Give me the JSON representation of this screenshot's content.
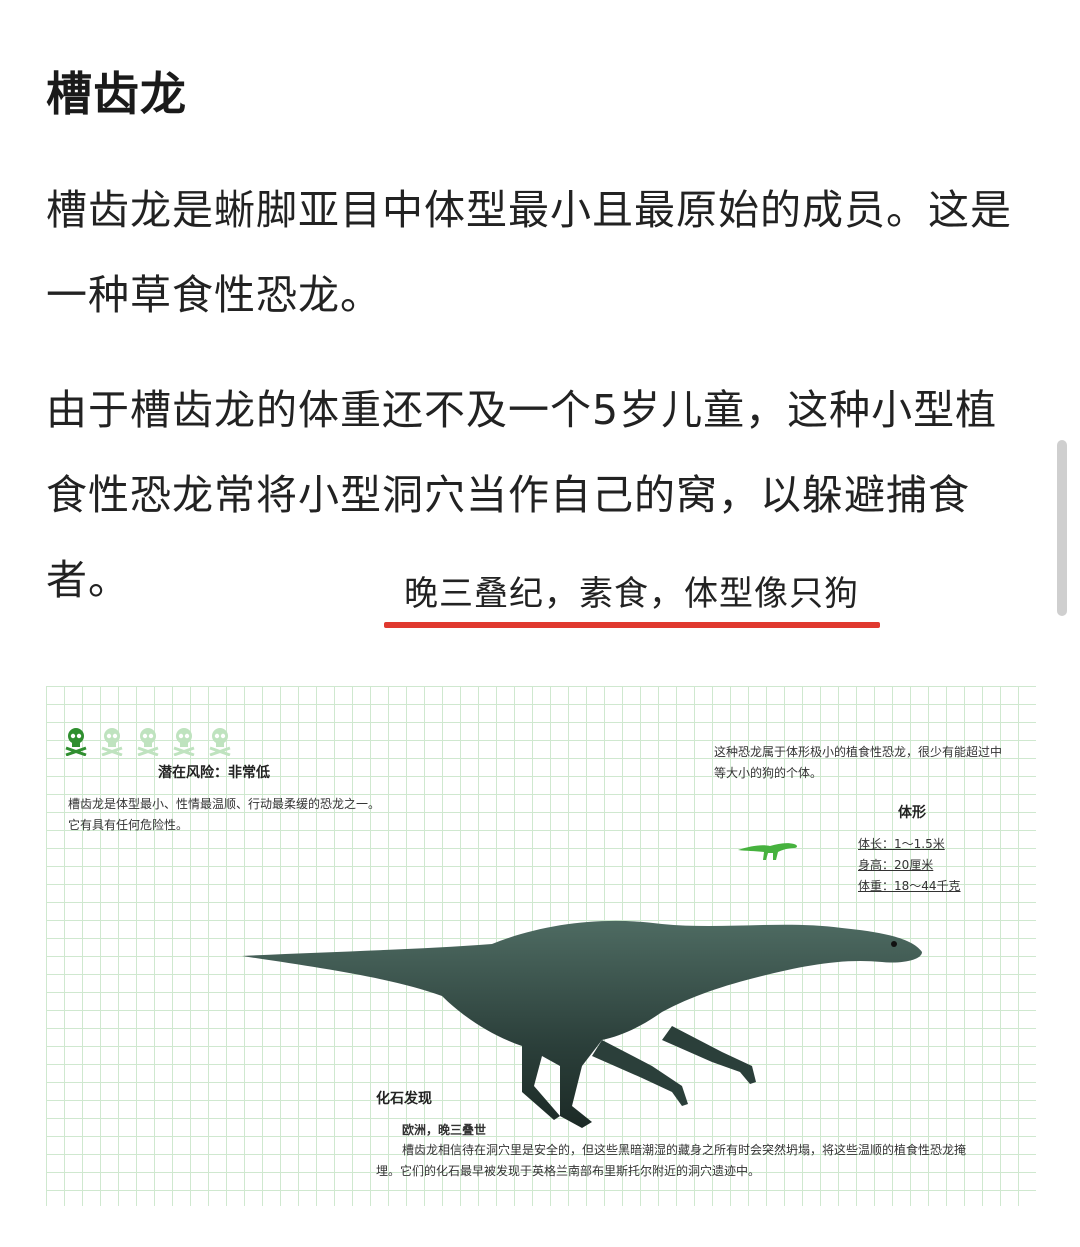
{
  "article": {
    "title": "槽齿龙",
    "paragraphs": [
      "槽齿龙是蜥脚亚目中体型最小且最原始的成员。这是一种草食性恐龙。",
      "由于槽齿龙的体重还不及一个5岁儿童，这种小型植食性恐龙常将小型洞穴当作自己的窝，以躲避捕食者。"
    ],
    "annotation": "晚三叠纪，素食，体型像只狗"
  },
  "figure": {
    "risk_label": "潜在风险：非常低",
    "risk_desc": "槽齿龙是体型最小、性情最温顺、行动最柔缓的恐龙之一。它有具有任何危险性。",
    "size_note": "这种恐龙属于体形极小的植食性恐龙，很少有能超过中等大小的狗的个体。",
    "body_label": "体形",
    "stats": [
      "体长：1～1.5米",
      "身高：20厘米",
      "体重：18～44千克"
    ],
    "fossil_head": "化石发现",
    "fossil_region": "欧洲，晚三叠世",
    "fossil_desc": "槽齿龙相信待在洞穴里是安全的，但这些黑暗潮湿的藏身之所有时会突然坍塌，将这些温顺的植食性恐龙掩埋。它们的化石最早被发现于英格兰南部布里斯托尔附近的洞穴遗迹中。",
    "risk_level": 1,
    "risk_max": 5
  },
  "colors": {
    "annotation_underline": "#e0392f",
    "skull_active": "#2f8f2f",
    "skull_inactive": "#bfe3bf",
    "grid": "#cfe8cf"
  },
  "icons": [
    "skull-icon",
    "dinosaur-silhouette-icon"
  ]
}
